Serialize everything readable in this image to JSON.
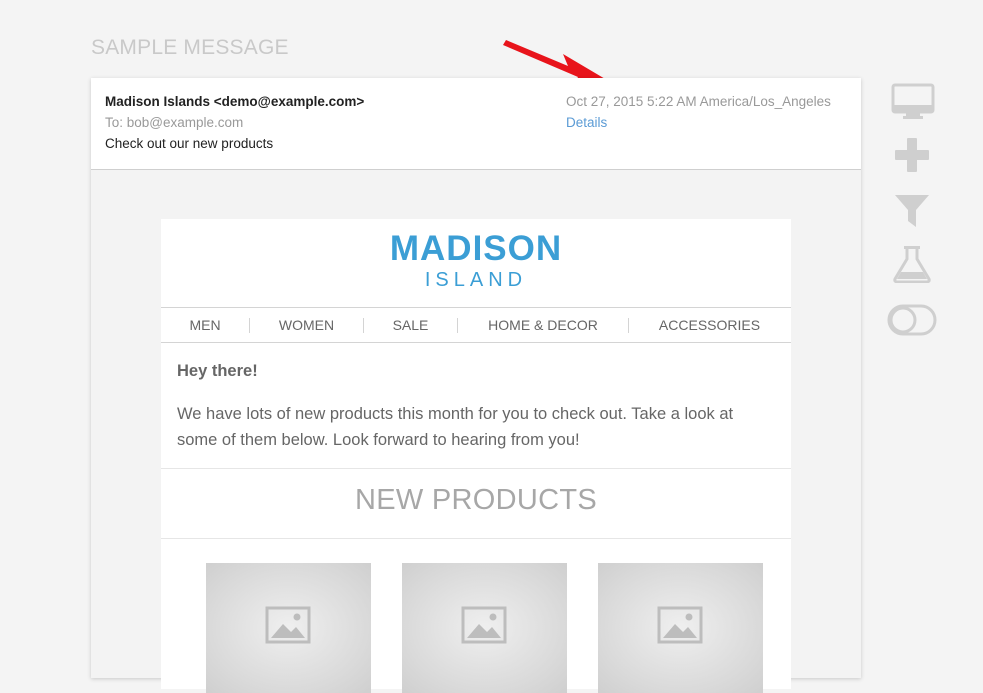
{
  "page": {
    "heading": "SAMPLE MESSAGE"
  },
  "message": {
    "from": "Madison Islands <demo@example.com>",
    "to": "To: bob@example.com",
    "subject": "Check out our new products",
    "date": "Oct 27, 2015 5:22 AM America/Los_Angeles",
    "details_link": "Details"
  },
  "email": {
    "logo_top": "MADISON",
    "logo_bottom": "ISLAND",
    "nav": [
      "MEN",
      "WOMEN",
      "SALE",
      "HOME & DECOR",
      "ACCESSORIES"
    ],
    "greeting": "Hey there!",
    "body": "We have lots of new products this month for you to check out. Take a look at some of them below. Look forward to hearing from you!",
    "section_title": "NEW PRODUCTS",
    "products": [
      {
        "icon": "image-placeholder-icon"
      },
      {
        "icon": "image-placeholder-icon"
      },
      {
        "icon": "image-placeholder-icon"
      }
    ]
  },
  "sidebar_tools": [
    {
      "icon": "desktop-icon"
    },
    {
      "icon": "plus-icon"
    },
    {
      "icon": "filter-icon"
    },
    {
      "icon": "flask-icon"
    },
    {
      "icon": "toggle-icon"
    }
  ],
  "colors": {
    "brand": "#3b9ed5",
    "link": "#5b9bd5",
    "annotation_arrow": "#e8141b",
    "tool_icon": "#cfcfcf"
  }
}
